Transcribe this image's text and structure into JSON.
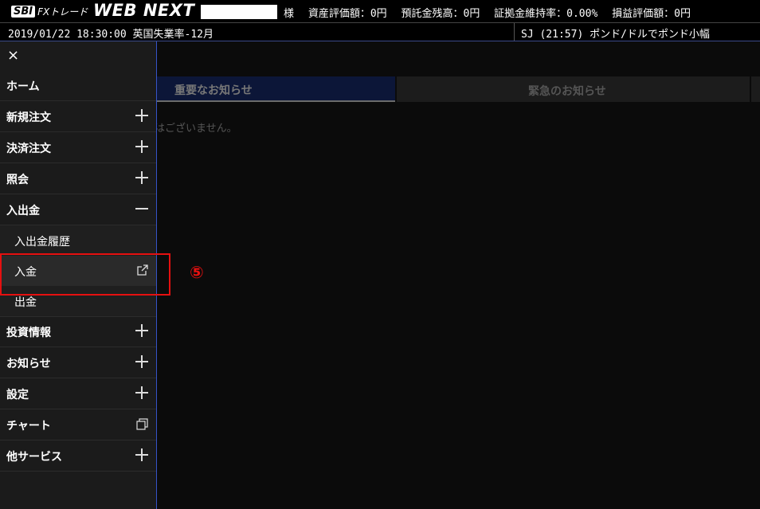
{
  "header": {
    "brand": "SBI",
    "fxtrade": "FXトレード",
    "product": "WEB NEXT",
    "honorific": "様",
    "stats": [
      "資産評価額：0円",
      "預託金残高：0円",
      "証拠金維持率：0.00%",
      "損益評価額：0円"
    ]
  },
  "infobar": {
    "datetime": "2019/01/22 18:30:00 英国失業率-12月",
    "ticker": "SJ    (21:57) ポンド/ドルでポンド小幅"
  },
  "sidebar": {
    "close": "×",
    "items": [
      {
        "label": "ホーム",
        "icon": "none"
      },
      {
        "label": "新規注文",
        "icon": "plus-icon"
      },
      {
        "label": "決済注文",
        "icon": "plus-icon"
      },
      {
        "label": "照会",
        "icon": "plus-icon"
      },
      {
        "label": "入出金",
        "icon": "minus-icon"
      },
      {
        "label": "入出金履歴",
        "icon": "none"
      },
      {
        "label": "入金",
        "icon": "external-link-icon"
      },
      {
        "label": "出金",
        "icon": "none"
      },
      {
        "label": "投資情報",
        "icon": "plus-icon"
      },
      {
        "label": "お知らせ",
        "icon": "plus-icon"
      },
      {
        "label": "設定",
        "icon": "plus-icon"
      },
      {
        "label": "チャート",
        "icon": "window-icon"
      },
      {
        "label": "他サービス",
        "icon": "plus-icon"
      }
    ]
  },
  "annotation": {
    "marker": "⑤",
    "color": "#e51010"
  },
  "tabs": [
    {
      "label": "重要なお知らせ"
    },
    {
      "label": "緊急のお知らせ"
    }
  ],
  "main": {
    "message": "はございません。"
  }
}
